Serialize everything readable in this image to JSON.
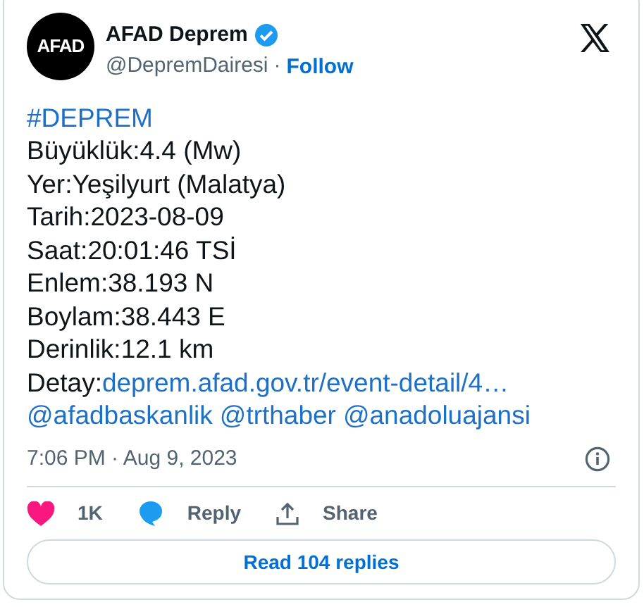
{
  "author": {
    "name": "AFAD Deprem",
    "avatar_text": "AFAD",
    "handle": "@DepremDairesi",
    "separator": "·",
    "follow": "Follow",
    "verified": true
  },
  "body": [
    [
      {
        "kind": "link",
        "text": "#DEPREM"
      }
    ],
    [
      {
        "kind": "text",
        "text": "Büyüklük:4.4 (Mw)"
      }
    ],
    [
      {
        "kind": "text",
        "text": "Yer:Yeşilyurt (Malatya)"
      }
    ],
    [
      {
        "kind": "text",
        "text": "Tarih:2023-08-09"
      }
    ],
    [
      {
        "kind": "text",
        "text": "Saat:20:01:46 TSİ"
      }
    ],
    [
      {
        "kind": "text",
        "text": "Enlem:38.193 N"
      }
    ],
    [
      {
        "kind": "text",
        "text": "Boylam:38.443 E"
      }
    ],
    [
      {
        "kind": "text",
        "text": "Derinlik:12.1 km"
      }
    ],
    [
      {
        "kind": "text",
        "text": "Detay:"
      },
      {
        "kind": "link",
        "text": "deprem.afad.gov.tr/event-detail/4…"
      }
    ],
    [
      {
        "kind": "link",
        "text": "@afadbaskanlik"
      },
      {
        "kind": "link",
        "text": "@trthaber"
      },
      {
        "kind": "link",
        "text": "@anadoluajansi"
      }
    ]
  ],
  "timestamp": "7:06 PM · Aug 9, 2023",
  "actions": [
    {
      "kind": "like",
      "label": "1K"
    },
    {
      "kind": "reply",
      "label": "Reply"
    },
    {
      "kind": "share",
      "label": "Share"
    }
  ],
  "read_replies": "Read 104 replies"
}
